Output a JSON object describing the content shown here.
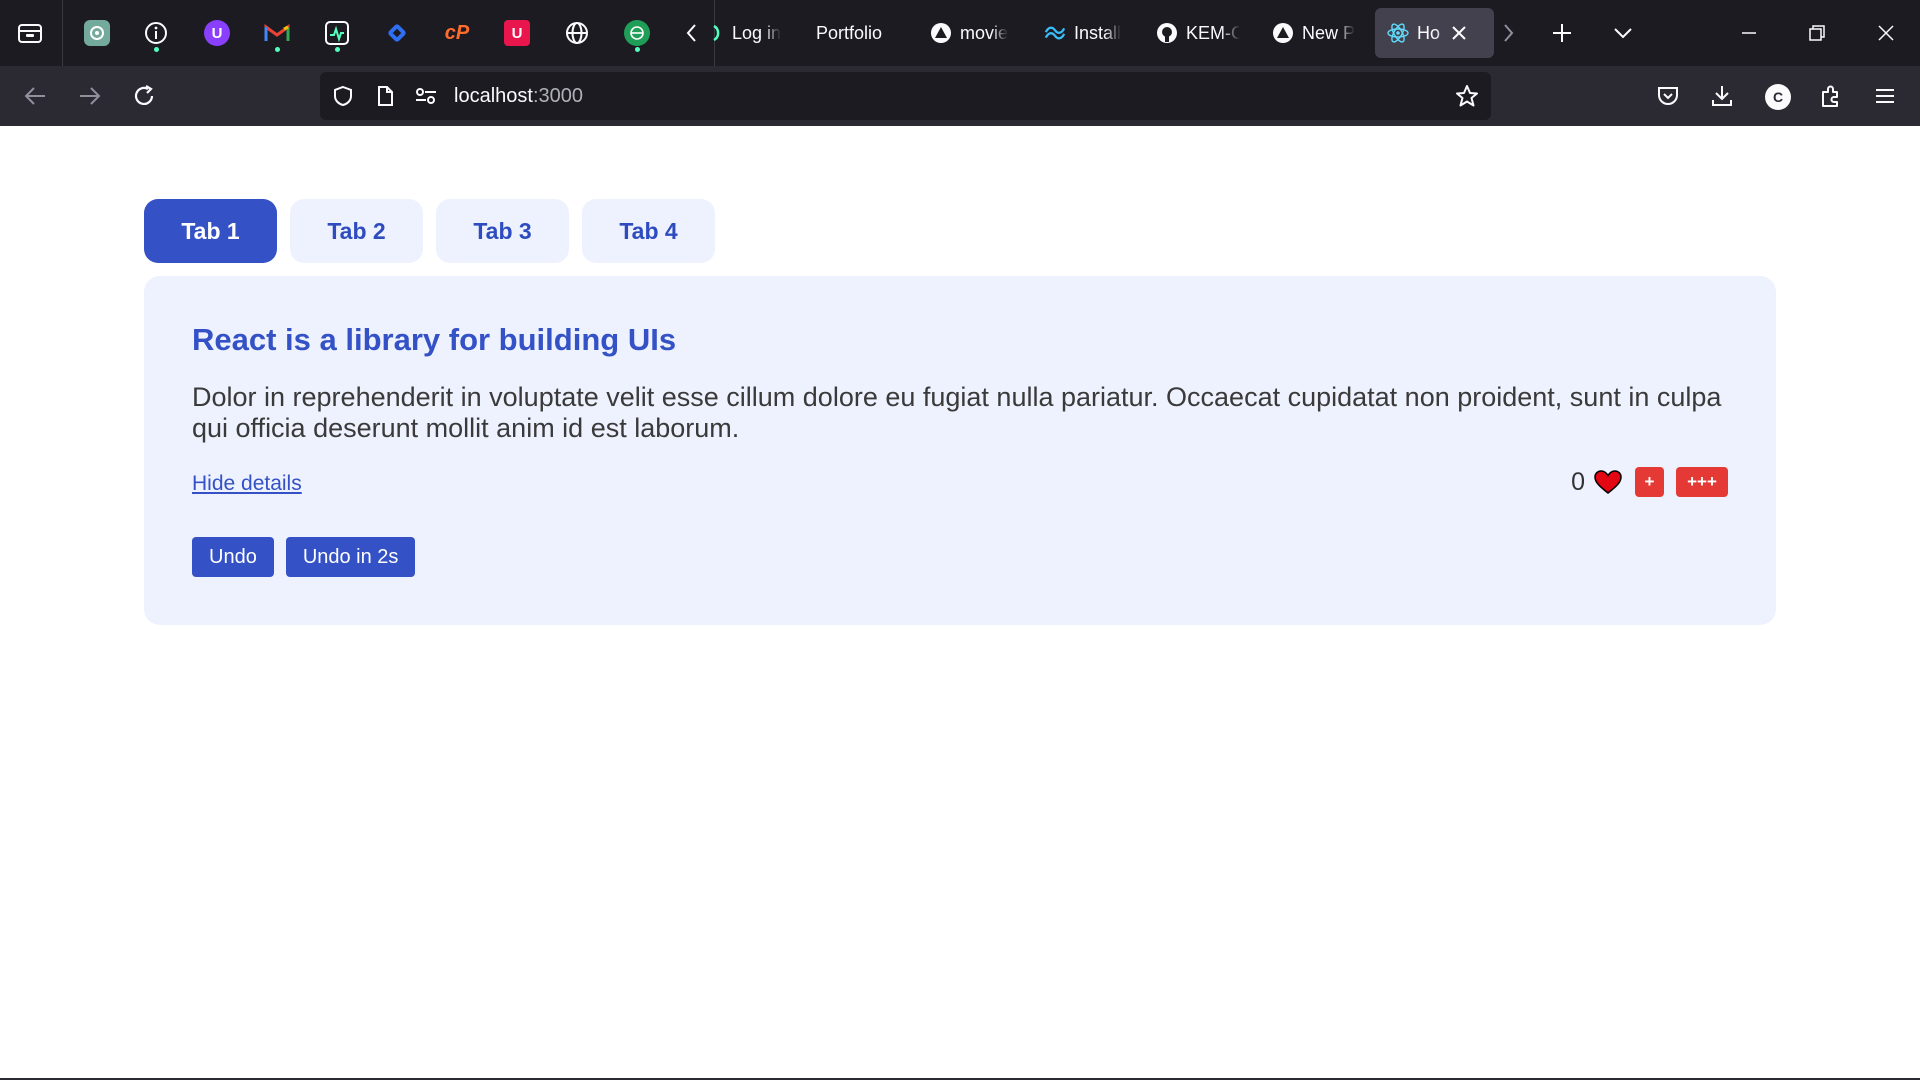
{
  "browser": {
    "tabs": [
      {
        "title": "Log in"
      },
      {
        "title": "Portfolio"
      },
      {
        "title": "movie"
      },
      {
        "title": "Install"
      },
      {
        "title": "KEM-C"
      },
      {
        "title": "New P"
      },
      {
        "title": "Ho",
        "active": true
      }
    ],
    "url": {
      "host": "localhost",
      "port": ":3000"
    }
  },
  "page": {
    "tabs": [
      {
        "label": "Tab 1",
        "active": true
      },
      {
        "label": "Tab 2"
      },
      {
        "label": "Tab 3"
      },
      {
        "label": "Tab 4"
      }
    ],
    "panel": {
      "title": "React is a library for building UIs",
      "description": "Dolor in reprehenderit in voluptate velit esse cillum dolore eu fugiat nulla pariatur. Occaecat cupidatat non proident, sunt in culpa qui officia deserunt mollit anim id est laborum.",
      "hide_link": "Hide details",
      "like_count": "0",
      "plus_label": "+",
      "plusplus_label": "+++",
      "undo_label": "Undo",
      "undo_delay_label": "Undo in 2s"
    },
    "colors": {
      "accent": "#3451c6",
      "panel_bg": "#edf2fe",
      "like_red": "#e53935"
    },
    "avatar_letter": "C"
  }
}
